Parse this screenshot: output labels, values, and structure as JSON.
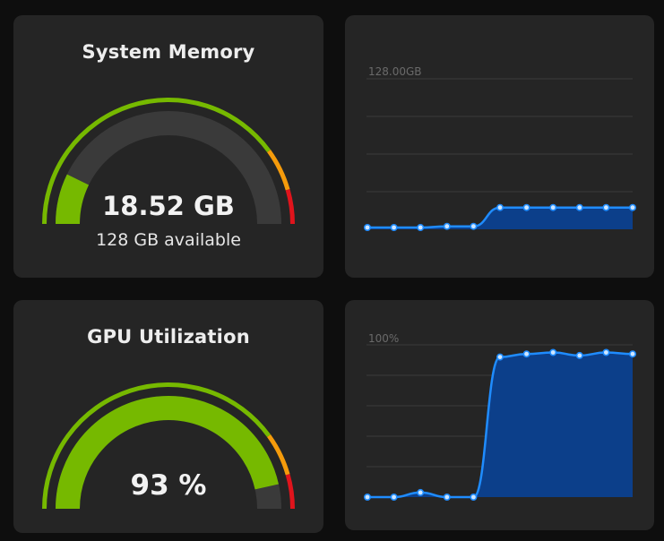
{
  "memory": {
    "title": "System Memory",
    "value": "18.52 GB",
    "available": "128 GB available",
    "gauge_fraction": 0.1447
  },
  "gpu": {
    "title": "GPU Utilization",
    "value": "93 %",
    "gauge_fraction": 0.93
  },
  "colors": {
    "green": "#76b900",
    "orange": "#f59b0b",
    "red": "#e0141c",
    "gauge_track": "#3a3a3a",
    "line": "#1f8cff",
    "area": "#0c3f8a"
  },
  "chart_data": [
    {
      "type": "area",
      "max_label": "128.00GB",
      "ylim": [
        0,
        128
      ],
      "grid": true,
      "x": [
        0,
        1,
        2,
        3,
        4,
        5,
        6,
        7,
        8,
        9,
        10
      ],
      "values": [
        1.5,
        1.5,
        1.5,
        2.5,
        2.5,
        18.5,
        18.5,
        18.5,
        18.5,
        18.5,
        18.5
      ]
    },
    {
      "type": "area",
      "max_label": "100%",
      "ylim": [
        0,
        100
      ],
      "grid": true,
      "x": [
        0,
        1,
        2,
        3,
        4,
        5,
        6,
        7,
        8,
        9,
        10
      ],
      "values": [
        0,
        0,
        3,
        0,
        0,
        92,
        94,
        95,
        93,
        95,
        94
      ]
    }
  ]
}
